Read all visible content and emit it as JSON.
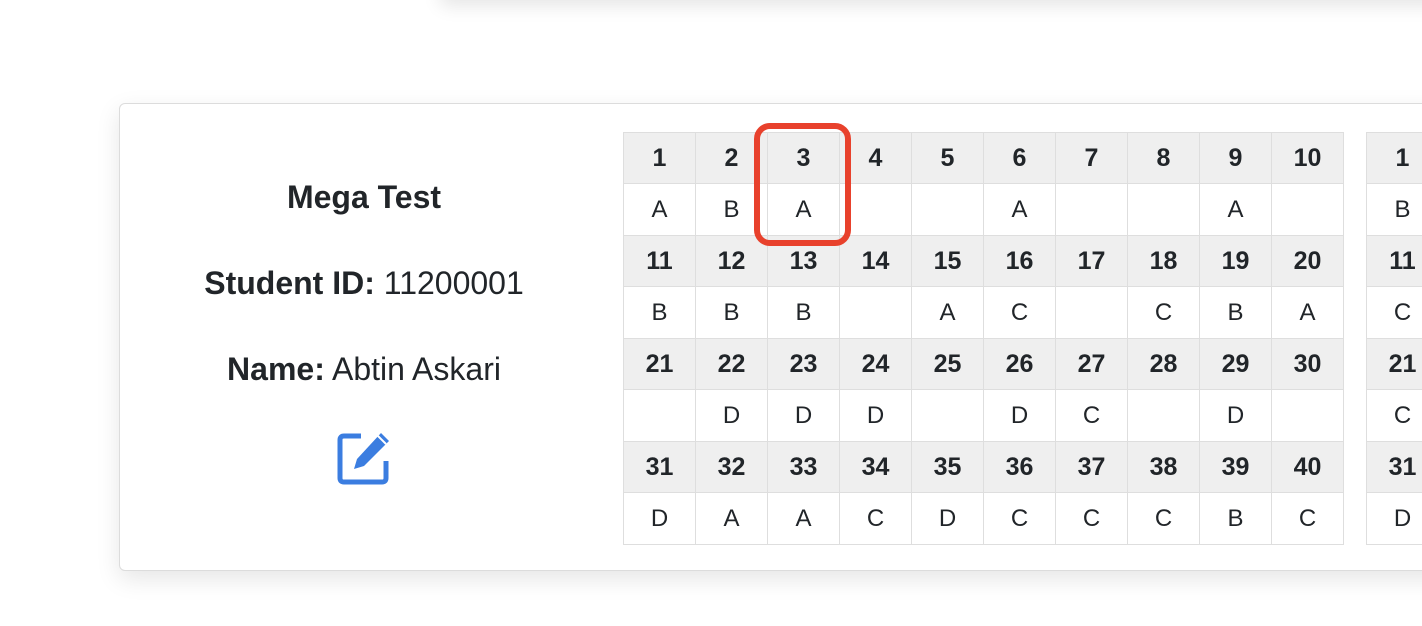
{
  "test": {
    "title": "Mega Test",
    "student_id_label": "Student ID:",
    "student_id": "11200001",
    "name_label": "Name:",
    "name": "Abtin Askari",
    "edit_icon": "edit-icon"
  },
  "grid": {
    "rows": [
      {
        "nums": [
          "1",
          "2",
          "3",
          "4",
          "5",
          "6",
          "7",
          "8",
          "9",
          "10"
        ],
        "answers": [
          "A",
          "B",
          "A",
          "",
          "",
          "A",
          "",
          "",
          "A",
          ""
        ]
      },
      {
        "nums": [
          "11",
          "12",
          "13",
          "14",
          "15",
          "16",
          "17",
          "18",
          "19",
          "20"
        ],
        "answers": [
          "B",
          "B",
          "B",
          "",
          "A",
          "C",
          "",
          "C",
          "B",
          "A"
        ]
      },
      {
        "nums": [
          "21",
          "22",
          "23",
          "24",
          "25",
          "26",
          "27",
          "28",
          "29",
          "30"
        ],
        "answers": [
          "",
          "D",
          "D",
          "D",
          "",
          "D",
          "C",
          "",
          "D",
          ""
        ]
      },
      {
        "nums": [
          "31",
          "32",
          "33",
          "34",
          "35",
          "36",
          "37",
          "38",
          "39",
          "40"
        ],
        "answers": [
          "D",
          "A",
          "A",
          "C",
          "D",
          "C",
          "C",
          "C",
          "B",
          "C"
        ]
      }
    ]
  },
  "grid2": {
    "rows": [
      {
        "nums": [
          "1"
        ],
        "answers": [
          "B"
        ]
      },
      {
        "nums": [
          "11"
        ],
        "answers": [
          "C"
        ]
      },
      {
        "nums": [
          "21"
        ],
        "answers": [
          "C"
        ]
      },
      {
        "nums": [
          "31"
        ],
        "answers": [
          "D"
        ]
      }
    ]
  },
  "highlight_color": "#e8412c",
  "accent_color": "#3b7de0"
}
